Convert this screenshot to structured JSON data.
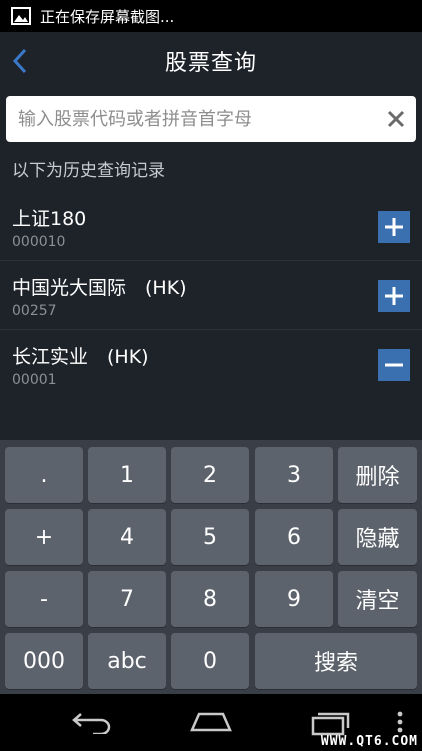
{
  "status_bar": {
    "notification_text": "正在保存屏幕截图..."
  },
  "header": {
    "title": "股票查询"
  },
  "search": {
    "placeholder": "输入股票代码或者拼音首字母",
    "value": ""
  },
  "history": {
    "label": "以下为历史查询记录",
    "items": [
      {
        "name": "上证180",
        "code": "000010",
        "action": "add"
      },
      {
        "name": "中国光大国际　(HK)",
        "code": "00257",
        "action": "add"
      },
      {
        "name": "长江实业　(HK)",
        "code": "00001",
        "action": "remove"
      }
    ]
  },
  "keyboard": {
    "row1": [
      ".",
      "1",
      "2",
      "3",
      "删除"
    ],
    "row2": [
      "+",
      "4",
      "5",
      "6",
      "隐藏"
    ],
    "row3": [
      "-",
      "7",
      "8",
      "9",
      "清空"
    ],
    "row4": [
      "000",
      "abc",
      "0",
      "搜索"
    ]
  },
  "watermark": "WWW.QT6.COM",
  "colors": {
    "accent": "#3a6fb0",
    "key": "#5d636c",
    "background": "#1e2229"
  }
}
